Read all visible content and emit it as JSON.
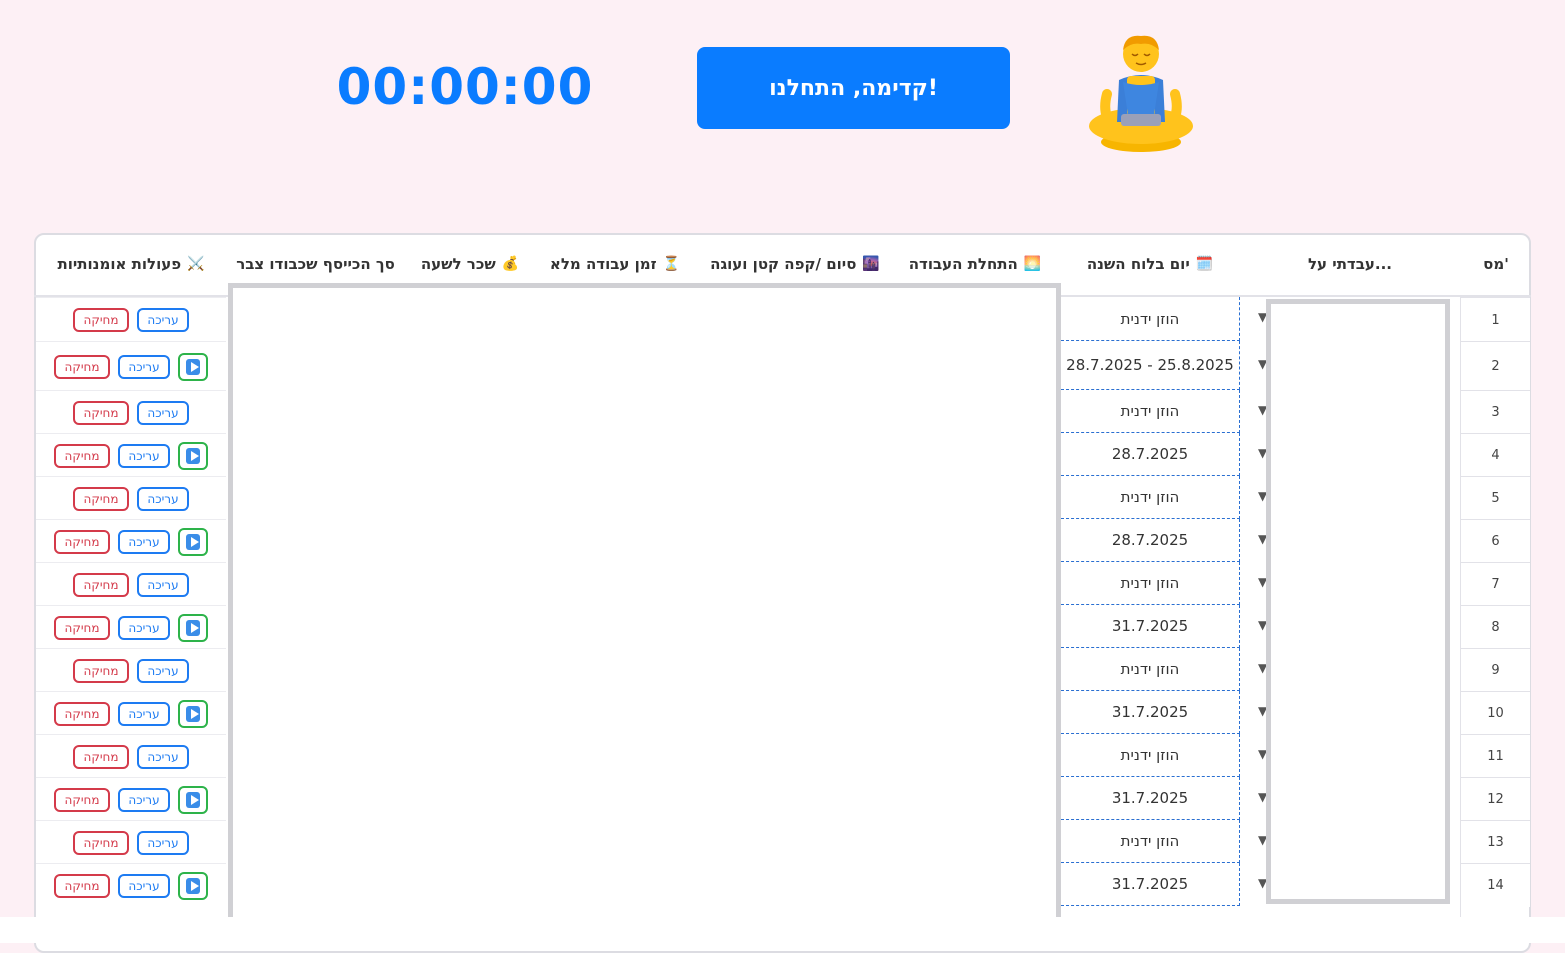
{
  "header": {
    "start_button": "קדימה, התחלנו!",
    "timer": "00:00:00",
    "avatar_icon": "meditating-person-icon"
  },
  "table": {
    "columns": [
      {
        "label": "מס'",
        "icon": ""
      },
      {
        "label": "עבדתי על...",
        "icon": ""
      },
      {
        "label": "יום בלוח השנה",
        "icon": "🗓️"
      },
      {
        "label": "התחלת העבודה",
        "icon": "🌅"
      },
      {
        "label": "סיום /קפה קטן ועוגה",
        "icon": "🌆"
      },
      {
        "label": "זמן עבודה מלא",
        "icon": "⏳"
      },
      {
        "label": "שכר לשעה",
        "icon": "💰"
      },
      {
        "label": "סך הכייסף שכבודו צבר",
        "icon": ""
      },
      {
        "label": "פעולות אומנותיות",
        "icon": "⚔️"
      }
    ],
    "rows": [
      {
        "num": "1",
        "day": "הוזן ידנית",
        "play": false
      },
      {
        "num": "2",
        "day": "28.7.2025 - 25.8.2025",
        "play": true
      },
      {
        "num": "3",
        "day": "הוזן ידנית",
        "play": false
      },
      {
        "num": "4",
        "day": "28.7.2025",
        "play": true
      },
      {
        "num": "5",
        "day": "הוזן ידנית",
        "play": false
      },
      {
        "num": "6",
        "day": "28.7.2025",
        "play": true
      },
      {
        "num": "7",
        "day": "הוזן ידנית",
        "play": false
      },
      {
        "num": "8",
        "day": "31.7.2025",
        "play": true
      },
      {
        "num": "9",
        "day": "הוזן ידנית",
        "play": false
      },
      {
        "num": "10",
        "day": "31.7.2025",
        "play": true
      },
      {
        "num": "11",
        "day": "הוזן ידנית",
        "play": false
      },
      {
        "num": "12",
        "day": "31.7.2025",
        "play": true
      },
      {
        "num": "13",
        "day": "הוזן ידנית",
        "play": false
      },
      {
        "num": "14",
        "day": "31.7.2025",
        "play": true
      }
    ],
    "edit_label": "עריכה",
    "delete_label": "מחיקה",
    "play_icon": "play-icon",
    "dropdown_icon": "dropdown-arrow-icon"
  }
}
